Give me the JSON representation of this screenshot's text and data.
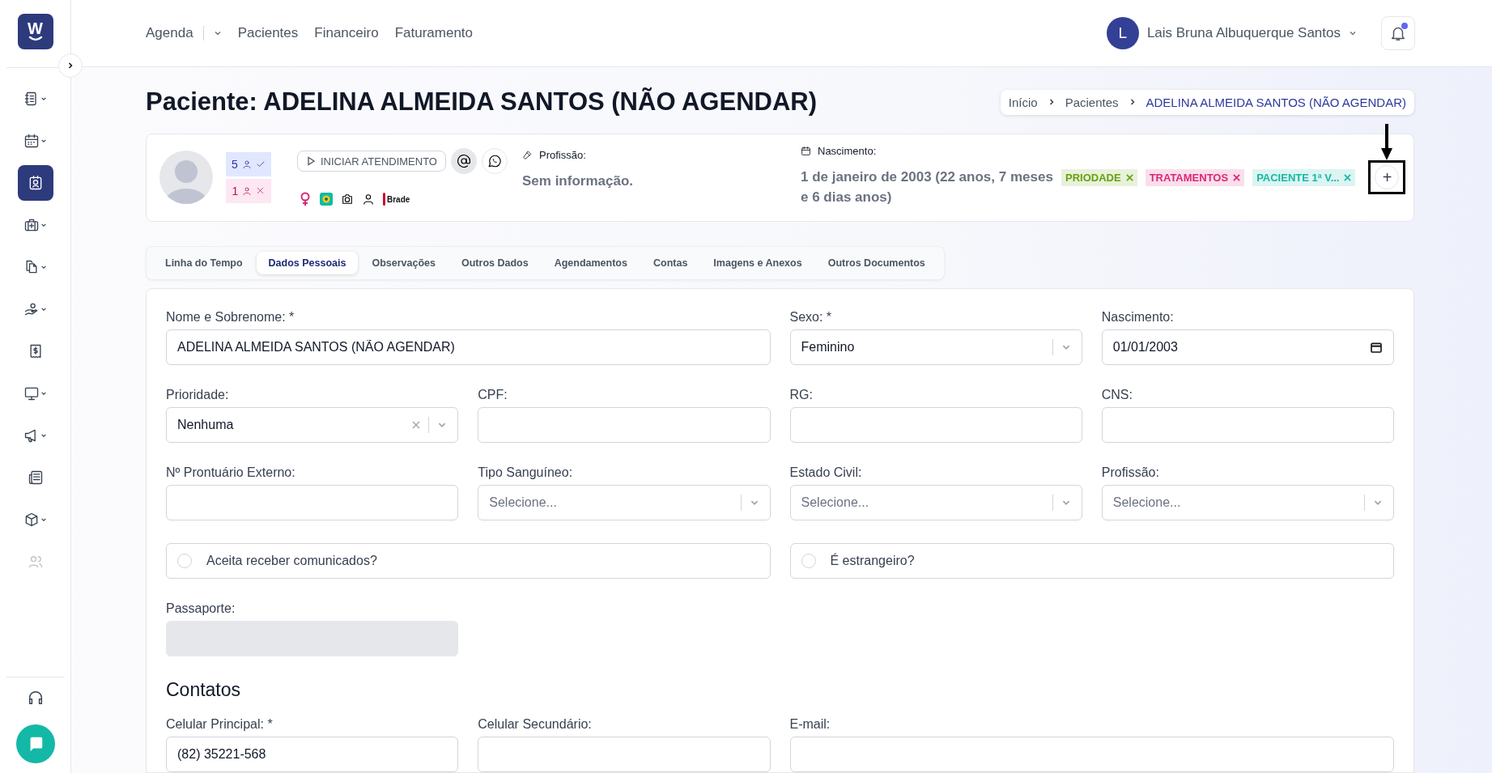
{
  "logo": {
    "letter": "W"
  },
  "sidebar": {
    "items": [
      {
        "selected": false,
        "has_menu": true,
        "disabled": false
      },
      {
        "selected": false,
        "has_menu": true,
        "disabled": false
      },
      {
        "selected": true,
        "has_menu": false,
        "disabled": false
      },
      {
        "selected": false,
        "has_menu": true,
        "disabled": false
      },
      {
        "selected": false,
        "has_menu": true,
        "disabled": false
      },
      {
        "selected": false,
        "has_menu": true,
        "disabled": false
      },
      {
        "selected": false,
        "has_menu": false,
        "disabled": false
      },
      {
        "selected": false,
        "has_menu": true,
        "disabled": false
      },
      {
        "selected": false,
        "has_menu": true,
        "disabled": false
      },
      {
        "selected": false,
        "has_menu": false,
        "disabled": false
      },
      {
        "selected": false,
        "has_menu": true,
        "disabled": false
      },
      {
        "selected": false,
        "has_menu": false,
        "disabled": true
      }
    ]
  },
  "topnav": [
    {
      "label": "Agenda",
      "has_menu": true
    },
    {
      "label": "Pacientes",
      "has_menu": false
    },
    {
      "label": "Financeiro",
      "has_menu": false
    },
    {
      "label": "Faturamento",
      "has_menu": false
    }
  ],
  "user": {
    "initial": "L",
    "name": "Lais Bruna Albuquerque Santos"
  },
  "notifications": {
    "unread": true
  },
  "page_title": "Paciente: ADELINA ALMEIDA SANTOS (NÃO AGENDAR)",
  "breadcrumb": [
    {
      "label": "Início",
      "current": false
    },
    {
      "label": "Pacientes",
      "current": false
    },
    {
      "label": "ADELINA ALMEIDA SANTOS (NÃO AGENDAR)",
      "current": true
    }
  ],
  "patient": {
    "attended": "5",
    "missed": "1",
    "start_button": "INICIAR ATENDIMENTO",
    "insurer": "Brade",
    "profession_label": "Profissão:",
    "profession": "Sem informação.",
    "birth_label": "Nascimento:",
    "birth": "1 de janeiro de 2003 (22 anos, 7 meses e 6 dias anos)",
    "tags": [
      {
        "label": "PRIODADE",
        "color": "#65a30d"
      },
      {
        "label": "TRATAMENTOS",
        "color": "#db2777"
      },
      {
        "label": "PACIENTE 1ª V...",
        "color": "#14b8a6"
      }
    ],
    "add_tag": "+",
    "add_tag_highlighted": true
  },
  "tabs": [
    {
      "label": "Linha do Tempo",
      "selected": false
    },
    {
      "label": "Dados Pessoais",
      "selected": true
    },
    {
      "label": "Observações",
      "selected": false
    },
    {
      "label": "Outros Dados",
      "selected": false
    },
    {
      "label": "Agendamentos",
      "selected": false
    },
    {
      "label": "Contas",
      "selected": false
    },
    {
      "label": "Imagens e Anexos",
      "selected": false
    },
    {
      "label": "Outros Documentos",
      "selected": false
    }
  ],
  "personal_fields": [
    {
      "kind": "text",
      "label": "Nome e Sobrenome: *",
      "value": "ADELINA ALMEIDA SANTOS (NÃO AGENDAR)",
      "disabled": false
    },
    {
      "kind": "select",
      "label": "Sexo: *",
      "value": "Feminino",
      "clearable": false
    },
    {
      "kind": "date",
      "label": "Nascimento:",
      "value": "01/01/2003"
    },
    {
      "kind": "select",
      "label": "Prioridade:",
      "value": "Nenhuma",
      "clearable": true
    },
    {
      "kind": "text",
      "label": "CPF:",
      "disabled": false
    },
    {
      "kind": "text",
      "label": "RG:",
      "disabled": false
    },
    {
      "kind": "text",
      "label": "CNS:",
      "disabled": false
    },
    {
      "kind": "text",
      "label": "Nº Prontuário Externo:",
      "disabled": false
    },
    {
      "kind": "select",
      "label": "Tipo Sanguíneo:",
      "placeholder": "Selecione...",
      "clearable": false
    },
    {
      "kind": "select",
      "label": "Estado Civil:",
      "placeholder": "Selecione...",
      "clearable": false
    },
    {
      "kind": "select",
      "label": "Profissão:",
      "placeholder": "Selecione...",
      "clearable": false
    },
    {
      "kind": "checkbox",
      "label": "Aceita receber comunicados?",
      "checked": false
    },
    {
      "kind": "checkbox",
      "label": "É estrangeiro?",
      "checked": false
    },
    {
      "kind": "text",
      "label": "Passaporte:",
      "disabled": true
    }
  ],
  "contacts": {
    "title": "Contatos",
    "fields": [
      {
        "kind": "text",
        "label": "Celular Principal: *",
        "value": "(82) 35221-568",
        "disabled": false
      },
      {
        "kind": "text",
        "label": "Celular Secundário:",
        "disabled": false
      },
      {
        "kind": "text",
        "label": "E-mail:",
        "disabled": false
      }
    ]
  }
}
